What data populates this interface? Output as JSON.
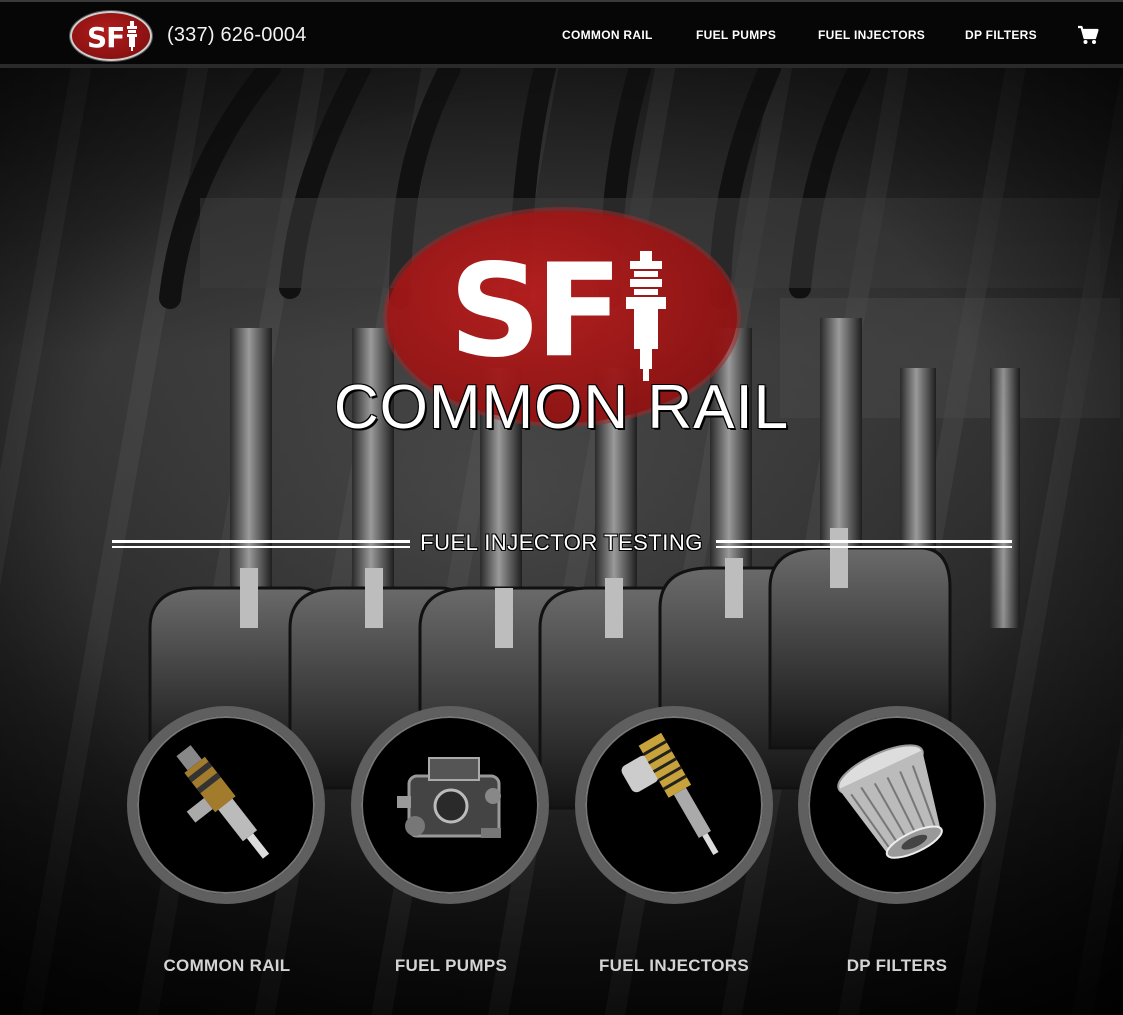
{
  "header": {
    "logo_text": "SF",
    "phone": "(337) 626-0004",
    "nav": [
      {
        "label": "COMMON RAIL"
      },
      {
        "label": "FUEL PUMPS"
      },
      {
        "label": "FUEL INJECTORS"
      },
      {
        "label": "DP FILTERS"
      }
    ],
    "cart_icon": "cart-icon"
  },
  "hero": {
    "logo_text": "SF",
    "title": "COMMON RAIL",
    "subtitle": "FUEL INJECTOR TESTING"
  },
  "categories": [
    {
      "label": "COMMON RAIL",
      "icon": "common-rail-injector-icon"
    },
    {
      "label": "FUEL PUMPS",
      "icon": "fuel-pump-icon"
    },
    {
      "label": "FUEL INJECTORS",
      "icon": "fuel-injector-icon"
    },
    {
      "label": "DP FILTERS",
      "icon": "dp-filter-icon"
    }
  ],
  "colors": {
    "brand_red": "#b21c1c",
    "header_bg": "#060606",
    "ring_gray": "#5f5f5f",
    "label_gray": "#d4d4d4"
  }
}
